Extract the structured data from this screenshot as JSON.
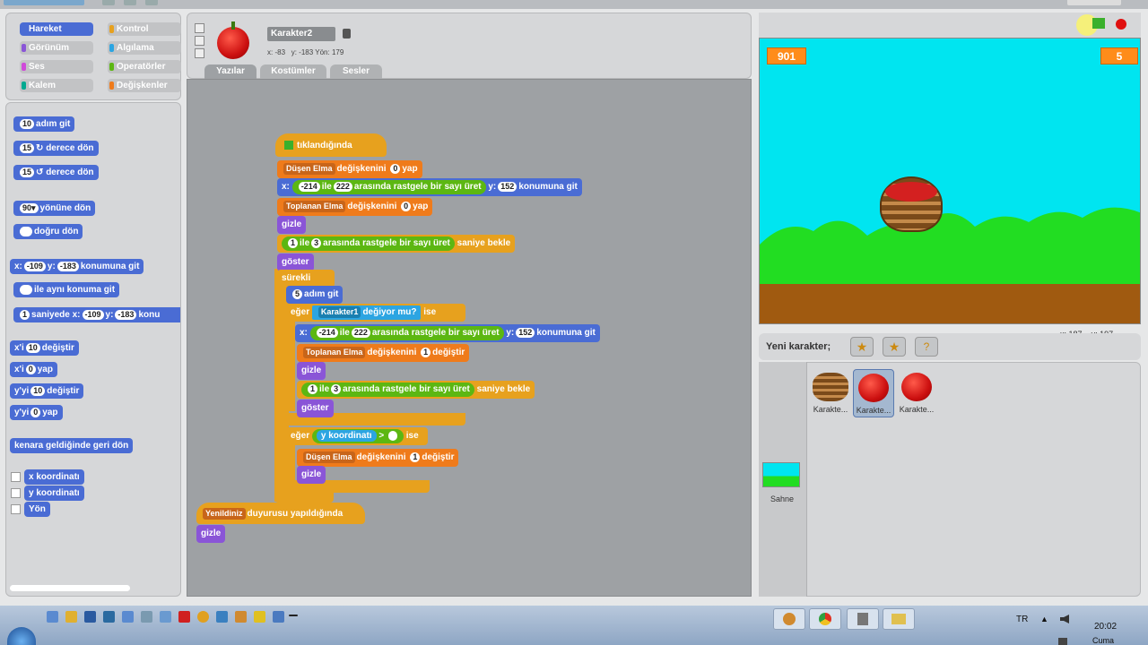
{
  "categories": [
    {
      "label": "Hareket",
      "color": "#4a6cd4",
      "active": true
    },
    {
      "label": "Kontrol",
      "color": "#e7a11e"
    },
    {
      "label": "Görünüm",
      "color": "#8a55d7"
    },
    {
      "label": "Algılama",
      "color": "#2ca5e2"
    },
    {
      "label": "Ses",
      "color": "#cf4ad9"
    },
    {
      "label": "Operatörler",
      "color": "#5cb712"
    },
    {
      "label": "Kalem",
      "color": "#00a990"
    },
    {
      "label": "Değişkenler",
      "color": "#ef7b1b"
    }
  ],
  "palette": {
    "move_steps_val": "10",
    "move_steps": "adım git",
    "turn_right_val": "15",
    "turn_right": "derece dön",
    "turn_left_val": "15",
    "turn_left": "derece dön",
    "point_dir_val": "90▾",
    "point_dir": "yönüne dön",
    "point_towards": "doğru dön",
    "goto_x_label": "x:",
    "goto_x": "-109",
    "goto_y_label": "y:",
    "goto_y": "-183",
    "goto_xy": "konumuna git",
    "goto_sprite": "ile aynı konuma git",
    "glide_val": "1",
    "glide": "saniyede x:",
    "glide_x": "-109",
    "glide_y_label": "y:",
    "glide_y": "-183",
    "glide_tail": "konu",
    "change_x_a": "x'i",
    "change_x_val": "10",
    "change_x_b": "değiştir",
    "set_x_a": "x'i",
    "set_x_val": "0",
    "set_x_b": "yap",
    "change_y_a": "y'yi",
    "change_y_val": "10",
    "change_y_b": "değiştir",
    "set_y_a": "y'yi",
    "set_y_val": "0",
    "set_y_b": "yap",
    "bounce": "kenara geldiğinde geri dön",
    "rep_x": "x koordinatı",
    "rep_y": "y koordinatı",
    "rep_dir": "Yön"
  },
  "sprite": {
    "name": "Karakter2",
    "x_label": "x:",
    "x": "-83",
    "y_label": "y:",
    "y": "-183",
    "dir_label": "Yön:",
    "dir": "179",
    "tabs": [
      "Yazılar",
      "Kostümler",
      "Sesler"
    ]
  },
  "script": {
    "hat": "tıklandığında",
    "set_var1": "Düşen Elma",
    "set_var1_b": "değişkenini",
    "set_var1_val": "0",
    "set_var1_c": "yap",
    "goto1_x": "x:",
    "goto1_xv": "-214",
    "goto1_ile": "ile",
    "goto1_max": "222",
    "goto1_rand": "arasında rastgele bir sayı üret",
    "goto1_y": "y:",
    "goto1_yv": "152",
    "goto1_tail": "konumuna git",
    "set_var2": "Toplanan Elma",
    "set_var2_b": "değişkenini",
    "set_var2_val": "0",
    "set_var2_c": "yap",
    "hide": "gizle",
    "wait_a": "1",
    "wait_ile": "ile",
    "wait_b": "3",
    "wait_rand": "arasında rastgele bir sayı üret",
    "wait_tail": "saniye bekle",
    "show": "göster",
    "forever": "sürekli",
    "move_val": "5",
    "move": "adım git",
    "if1": "eğer",
    "touch_sprite": "Karakter1",
    "touching": "değiyor mu?",
    "then1": "ise",
    "goto2_x": "x:",
    "goto2_xv": "-214",
    "goto2_ile": "ile",
    "goto2_max": "222",
    "goto2_rand": "arasında rastgele bir sayı üret",
    "goto2_y": "y:",
    "goto2_yv": "152",
    "goto2_tail": "konumuna git",
    "change_var": "Toplanan Elma",
    "change_var_b": "değişkenini",
    "change_var_val": "1",
    "change_var_c": "değiştir",
    "hide2": "gizle",
    "wait2_a": "1",
    "wait2_ile": "ile",
    "wait2_b": "3",
    "wait2_rand": "arasında rastgele bir sayı üret",
    "wait2_tail": "saniye bekle",
    "show2": "göster",
    "if2": "eğer",
    "ycoord": "y koordinatı",
    "gt": ">",
    "then2": "ise",
    "change_var2": "Düşen Elma",
    "change_var2_b": "değişkenini",
    "change_var2_val": "1",
    "change_var2_c": "değiştir",
    "hide3": "gizle",
    "broadcast": "Yenildiniz",
    "broadcast_b": "duyurusu yapıldığında",
    "hide4": "gizle"
  },
  "stage": {
    "monitor_left": "901",
    "monitor_right": "5",
    "mouse_x_label": "x:",
    "mouse_x": "187",
    "mouse_y_label": "y:",
    "mouse_y": "197"
  },
  "sprites_panel": {
    "new_sprite": "Yeni karakter;",
    "stage_label": "Sahne",
    "sprites": [
      {
        "name": "Karakte...",
        "icon": "basket-icon"
      },
      {
        "name": "Karakte...",
        "icon": "apple-icon",
        "selected": true
      },
      {
        "name": "Karakte...",
        "icon": "apple-icon"
      }
    ]
  },
  "taskbar": {
    "lang": "TR",
    "time": "20:02",
    "day": "Cuma"
  },
  "colors": {
    "motion": "#4a6cd4",
    "control": "#e7a11e",
    "variables": "#ef7b1b",
    "looks": "#8a55d7",
    "operators": "#5cb712",
    "sensing": "#2ca5e2",
    "stage_sky": "#00e5f0",
    "grass": "#22dd22",
    "soil": "#a05a10"
  }
}
